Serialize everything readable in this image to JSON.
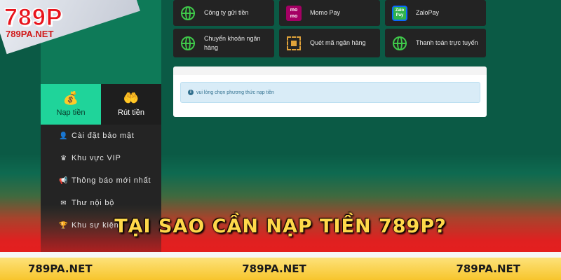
{
  "brand": {
    "logo_text": "789P",
    "site": "789PA.NET"
  },
  "sidebar": {
    "tabs": [
      {
        "label": "Nạp tiền",
        "icon": "money-bag-icon",
        "active": true
      },
      {
        "label": "Rút tiền",
        "icon": "hand-money-icon",
        "active": false
      }
    ],
    "menu": [
      {
        "label": "Cài đặt bảo mật",
        "icon": "user-lock-icon"
      },
      {
        "label": "Khu vực VIP",
        "icon": "crown-icon"
      },
      {
        "label": "Thông báo mới nhất",
        "icon": "megaphone-icon"
      },
      {
        "label": "Thư nội bộ",
        "icon": "envelope-icon"
      },
      {
        "label": "Khu sự kiện",
        "icon": "trophy-icon"
      }
    ]
  },
  "methods": [
    {
      "label": "Công ty gửi tiền",
      "icon": "globe-icon"
    },
    {
      "label": "Momo Pay",
      "icon": "momo-icon",
      "icon_text": "mo mo"
    },
    {
      "label": "ZaloPay",
      "icon": "zalopay-icon",
      "icon_text": "Zalo Pay"
    },
    {
      "label": "Chuyển khoản ngân hàng",
      "icon": "globe-icon"
    },
    {
      "label": "Quét mã ngân hàng",
      "icon": "qr-code-icon"
    },
    {
      "label": "Thanh toán trực tuyến",
      "icon": "globe-icon"
    }
  ],
  "info": {
    "message": "vui lòng chọn phương thức nạp tiền"
  },
  "headline": "TẠI SAO CẦN NẠP TIỀN 789P?",
  "footer": {
    "links": [
      "789PA.NET",
      "789PA.NET",
      "789PA.NET"
    ]
  },
  "colors": {
    "accent": "#1fd49a",
    "background": "#0b5a45",
    "headline": "#ffd84a",
    "footer": "#f7c52c",
    "brand_red": "#e8141c"
  }
}
